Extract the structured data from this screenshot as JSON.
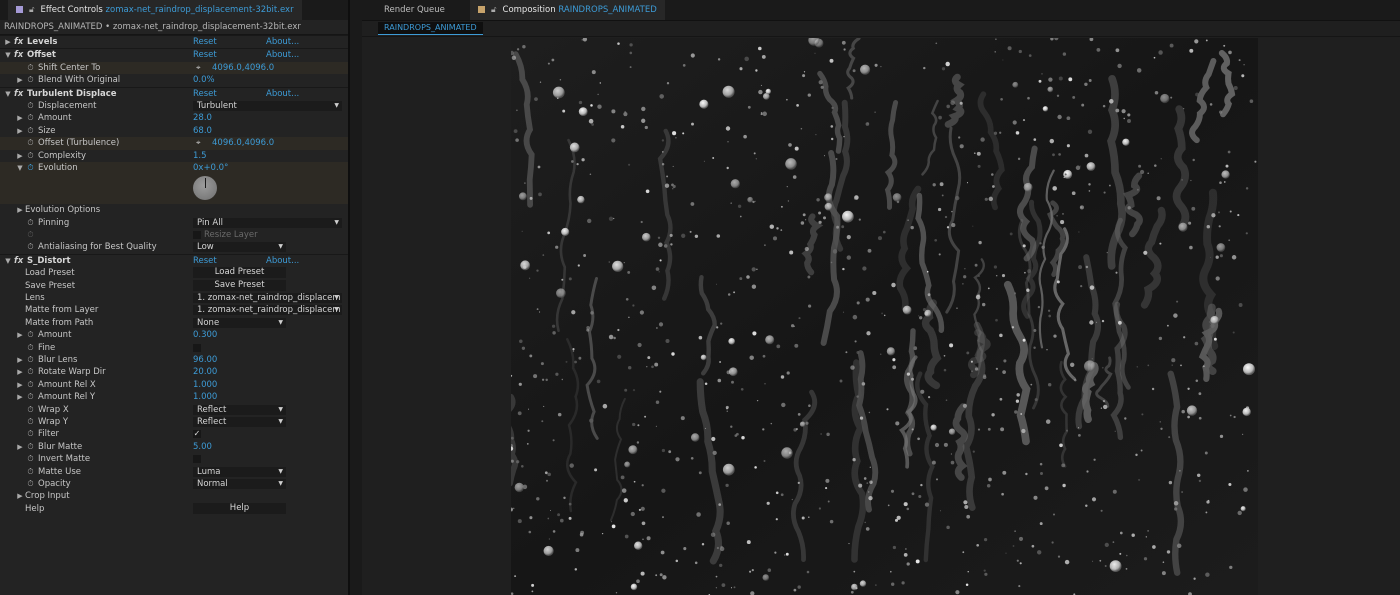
{
  "effect_controls_tab": {
    "title": "Effect Controls",
    "file": "zomax-net_raindrop_displacement-32bit.exr"
  },
  "breadcrumb": "RAINDROPS_ANIMATED • zomax-net_raindrop_displacement-32bit.exr",
  "render_queue_tab": "Render Queue",
  "composition_tab": {
    "title": "Composition",
    "name": "RAINDROPS_ANIMATED"
  },
  "comp_label": "RAINDROPS_ANIMATED",
  "labels": {
    "reset": "Reset",
    "about": "About..."
  },
  "effects": {
    "levels": "Levels",
    "offset": {
      "name": "Offset",
      "shift_center_to": "Shift Center To",
      "shift_center_val": "4096.0,4096.0",
      "blend_with_original": "Blend With Original",
      "blend_val": "0.0%"
    },
    "turbulent": {
      "name": "Turbulent Displace",
      "displacement": "Displacement",
      "displacement_val": "Turbulent",
      "amount": "Amount",
      "amount_val": "28.0",
      "size": "Size",
      "size_val": "68.0",
      "offset": "Offset (Turbulence)",
      "offset_val": "4096.0,4096.0",
      "complexity": "Complexity",
      "complexity_val": "1.5",
      "evolution": "Evolution",
      "evolution_val": "0x+0.0°",
      "evolution_options": "Evolution Options",
      "pinning": "Pinning",
      "pinning_val": "Pin All",
      "resize_layer": "Resize Layer",
      "antialiasing": "Antialiasing for Best Quality",
      "antialiasing_val": "Low"
    },
    "sdistort": {
      "name": "S_Distort",
      "load_preset": "Load Preset",
      "load_preset_btn": "Load Preset",
      "save_preset": "Save Preset",
      "save_preset_btn": "Save Preset",
      "lens": "Lens",
      "lens_val": "1. zomax-net_raindrop_displacem",
      "matte_from_layer": "Matte from Layer",
      "matte_from_layer_val": "1. zomax-net_raindrop_displacem",
      "matte_from_path": "Matte from Path",
      "matte_from_path_val": "None",
      "amount": "Amount",
      "amount_val": "0.300",
      "fine": "Fine",
      "blur_lens": "Blur Lens",
      "blur_lens_val": "96.00",
      "rotate_warp_dir": "Rotate Warp Dir",
      "rotate_warp_dir_val": "20.00",
      "amount_rel_x": "Amount Rel X",
      "amount_rel_x_val": "1.000",
      "amount_rel_y": "Amount Rel Y",
      "amount_rel_y_val": "1.000",
      "wrap_x": "Wrap X",
      "wrap_x_val": "Reflect",
      "wrap_y": "Wrap Y",
      "wrap_y_val": "Reflect",
      "filter": "Filter",
      "filter_check": "✓",
      "blur_matte": "Blur Matte",
      "blur_matte_val": "5.00",
      "invert_matte": "Invert Matte",
      "matte_use": "Matte Use",
      "matte_use_val": "Luma",
      "opacity": "Opacity",
      "opacity_val": "Normal",
      "crop_input": "Crop Input",
      "help": "Help",
      "help_btn": "Help"
    }
  },
  "colors": {
    "accent_blue": "#3d9bd6",
    "effect_controls_swatch": "#a59ad6",
    "composition_swatch": "#c7a36b",
    "panel_bg": "#232323",
    "highlight_row": "#2d2a24"
  }
}
